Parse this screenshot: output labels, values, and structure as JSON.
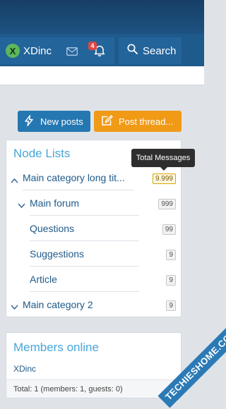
{
  "header": {
    "username": "XDinc",
    "avatar_letter": "X",
    "notification_count": "4",
    "search_label": "Search"
  },
  "actions": {
    "new_posts": "New posts",
    "post_thread": "Post thread..."
  },
  "node_list": {
    "title": "Node Lists",
    "tooltip": "Total Messages",
    "items": [
      {
        "label": "Main category long tit...",
        "count": "9.999"
      },
      {
        "label": "Main forum",
        "count": "999"
      },
      {
        "label": "Questions",
        "count": "99"
      },
      {
        "label": "Suggestions",
        "count": "9"
      },
      {
        "label": "Article",
        "count": "9"
      },
      {
        "label": "Main category 2",
        "count": "9"
      }
    ]
  },
  "members_online": {
    "title": "Members online",
    "members": [
      "XDinc"
    ],
    "total": "Total: 1 (members: 1, guests: 0)"
  },
  "watermark": "TECHIESHOME.COM",
  "colors": {
    "header_dark": "#173f66",
    "nav": "#1f5a8c",
    "button_primary": "#2577b1",
    "button_cta": "#f09a16",
    "block_title": "#47a7d9",
    "link": "#1e5a8a"
  }
}
